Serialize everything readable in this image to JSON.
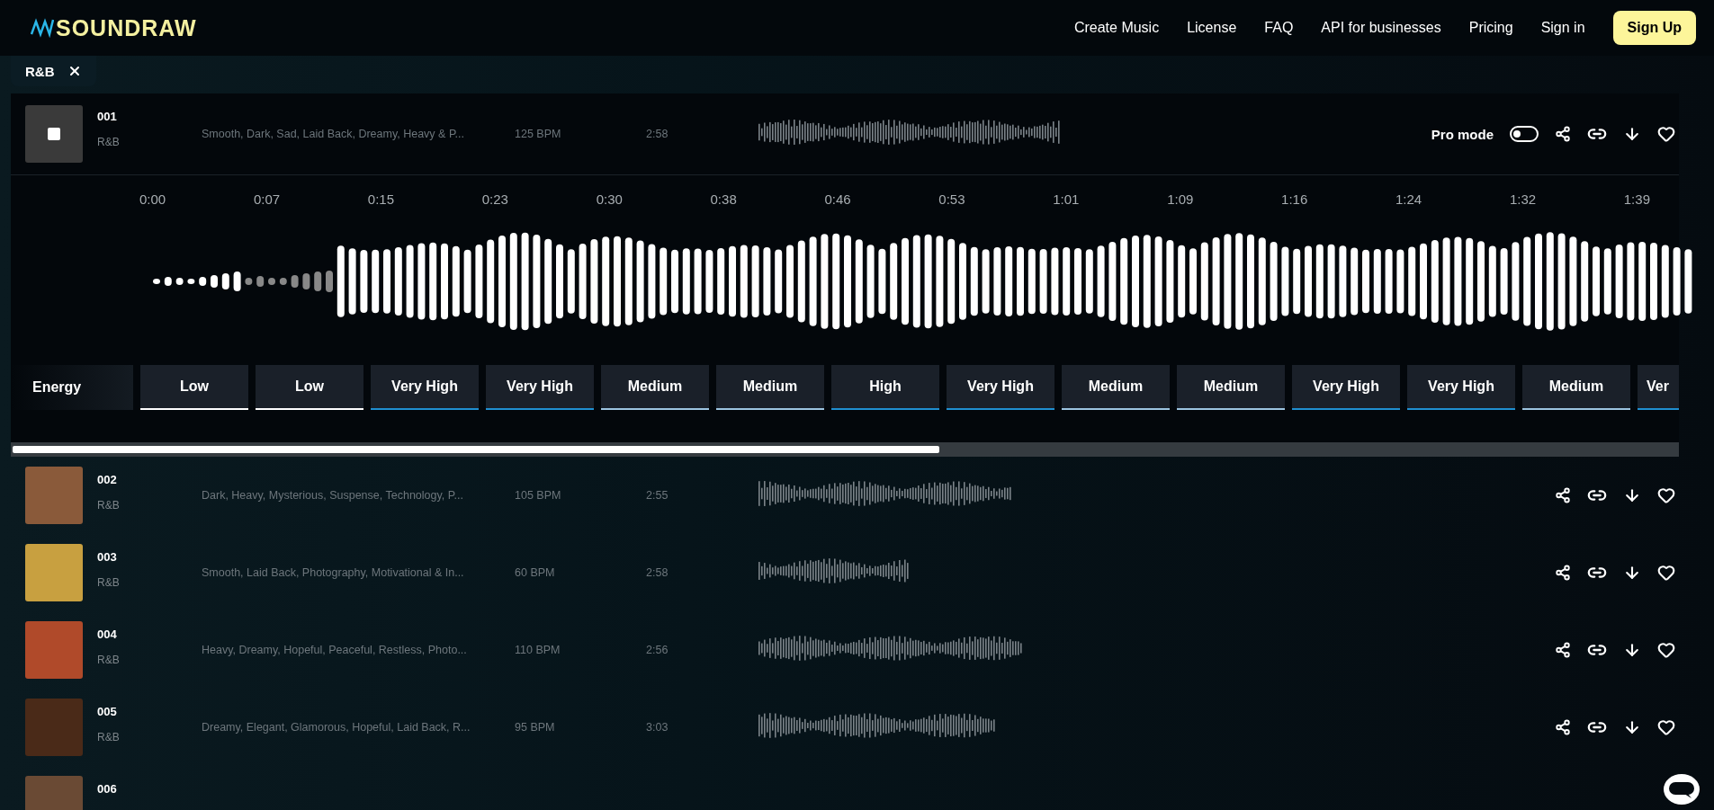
{
  "header": {
    "logo": "SOUNDRAW",
    "nav": [
      "Create Music",
      "License",
      "FAQ",
      "API for businesses",
      "Pricing",
      "Sign in"
    ],
    "cta": "Sign Up"
  },
  "filters": [
    {
      "label": "R&B"
    }
  ],
  "tracks": [
    {
      "number": "001",
      "genre": "R&B",
      "tags": "Smooth, Dark, Sad, Laid Back, Dreamy, Heavy & P...",
      "bpm": "125 BPM",
      "duration": "2:58",
      "playing": true,
      "expanded": true,
      "pro_mode": {
        "label": "Pro mode",
        "on": false
      }
    },
    {
      "number": "002",
      "genre": "R&B",
      "tags": "Dark, Heavy, Mysterious, Suspense, Technology, P...",
      "bpm": "105 BPM",
      "duration": "2:55",
      "playing": false,
      "expanded": false
    },
    {
      "number": "003",
      "genre": "R&B",
      "tags": "Smooth, Laid Back, Photography, Motivational & In...",
      "bpm": "60 BPM",
      "duration": "2:58",
      "playing": false,
      "expanded": false
    },
    {
      "number": "004",
      "genre": "R&B",
      "tags": "Heavy, Dreamy, Hopeful, Peaceful, Restless, Photo...",
      "bpm": "110 BPM",
      "duration": "2:56",
      "playing": false,
      "expanded": false
    },
    {
      "number": "005",
      "genre": "R&B",
      "tags": "Dreamy, Elegant, Glamorous, Hopeful, Laid Back, R...",
      "bpm": "95 BPM",
      "duration": "3:03",
      "playing": false,
      "expanded": false
    },
    {
      "number": "006",
      "playing": false,
      "expanded": false
    }
  ],
  "detail": {
    "timeline": [
      "0:00",
      "0:07",
      "0:15",
      "0:23",
      "0:30",
      "0:38",
      "0:46",
      "0:53",
      "1:01",
      "1:09",
      "1:16",
      "1:24",
      "1:32",
      "1:39"
    ],
    "energy": {
      "label": "Energy",
      "cells": [
        {
          "text": "Low",
          "color": "#ffffff"
        },
        {
          "text": "Low",
          "color": "#ffffff"
        },
        {
          "text": "Very High",
          "color": "#1f8fd0"
        },
        {
          "text": "Very High",
          "color": "#1f8fd0"
        },
        {
          "text": "Medium",
          "color": "#9cc4e0"
        },
        {
          "text": "Medium",
          "color": "#9cc4e0"
        },
        {
          "text": "High",
          "color": "#1f8fd0"
        },
        {
          "text": "Very High",
          "color": "#1f8fd0"
        },
        {
          "text": "Medium",
          "color": "#9cc4e0"
        },
        {
          "text": "Medium",
          "color": "#9cc4e0"
        },
        {
          "text": "Very High",
          "color": "#1f8fd0"
        },
        {
          "text": "Very High",
          "color": "#1f8fd0"
        },
        {
          "text": "Medium",
          "color": "#9cc4e0"
        },
        {
          "text": "Ver",
          "color": "#1f8fd0"
        }
      ]
    }
  }
}
